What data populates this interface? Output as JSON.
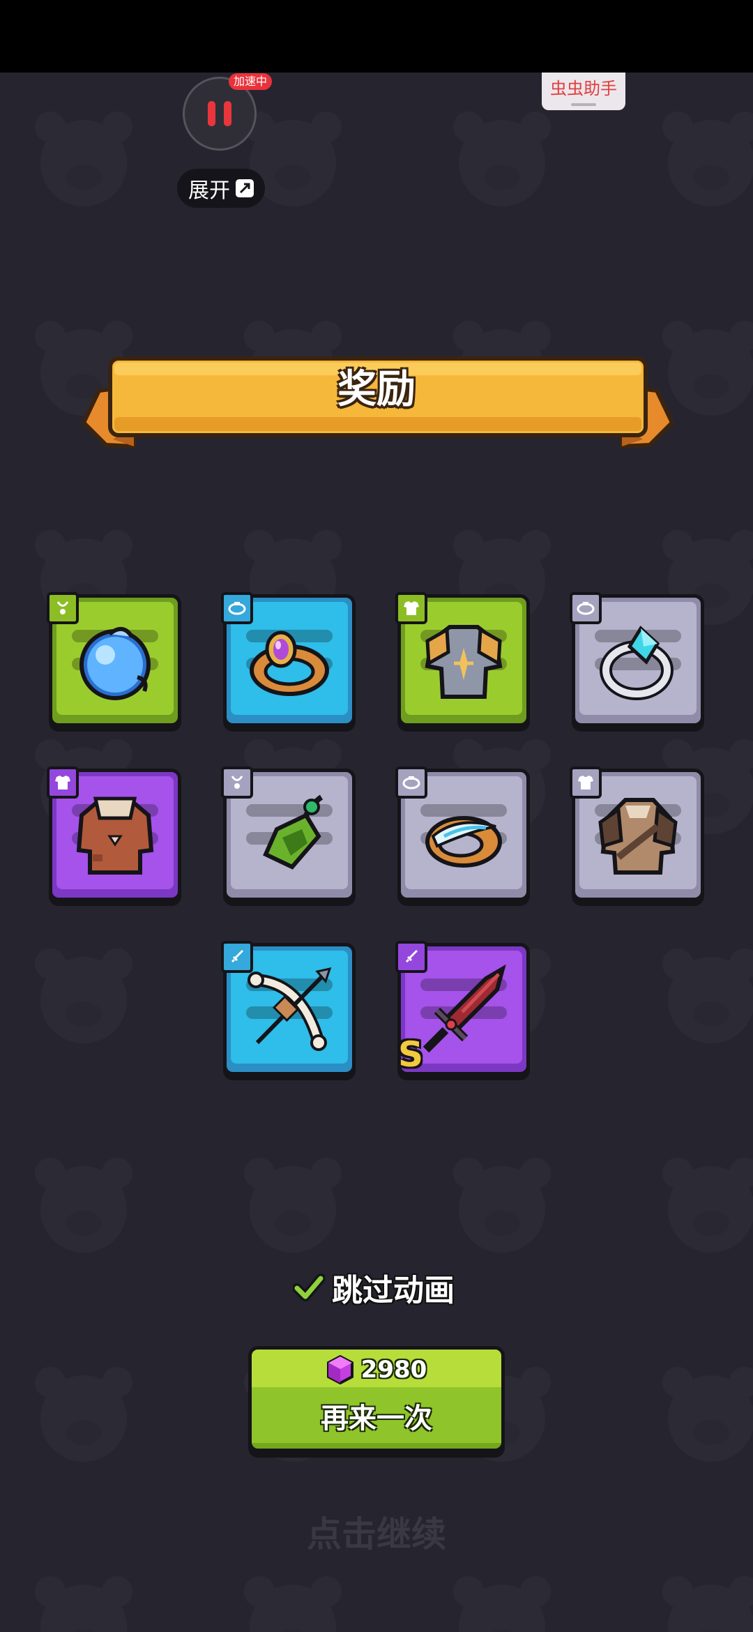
{
  "overlay": {
    "speed_badge": "加速中",
    "expand_label": "展开",
    "helper_label": "虫虫助手"
  },
  "banner": {
    "title": "奖励"
  },
  "rewards": [
    {
      "item": "blue-orb",
      "slot": "necklace",
      "rarity": "green"
    },
    {
      "item": "gem-ring",
      "slot": "ring",
      "rarity": "blue"
    },
    {
      "item": "plate-armor",
      "slot": "armor",
      "rarity": "green"
    },
    {
      "item": "crystal-ring",
      "slot": "ring",
      "rarity": "grey"
    },
    {
      "item": "leather-vest",
      "slot": "armor",
      "rarity": "purple"
    },
    {
      "item": "green-amulet",
      "slot": "necklace",
      "rarity": "grey"
    },
    {
      "item": "feather-ring",
      "slot": "ring",
      "rarity": "grey"
    },
    {
      "item": "fur-armor",
      "slot": "armor",
      "rarity": "grey"
    },
    {
      "item": "bone-bow",
      "slot": "weapon",
      "rarity": "blue"
    },
    {
      "item": "red-sword",
      "slot": "weapon",
      "rarity": "purple",
      "rank": "S"
    }
  ],
  "skip_animation": {
    "label": "跳过动画",
    "checked": true
  },
  "retry": {
    "cost": "2980",
    "label": "再来一次",
    "currency_icon": "purple-gem-icon"
  },
  "tap_continue": "点击继续",
  "colors": {
    "background": "#26242f",
    "banner": "#f6b83a",
    "rarity_green": "#9bcc2e",
    "rarity_blue": "#2fbde9",
    "rarity_grey": "#b6b3cd",
    "rarity_purple": "#a553ea",
    "button_green": "#8fc42a"
  }
}
